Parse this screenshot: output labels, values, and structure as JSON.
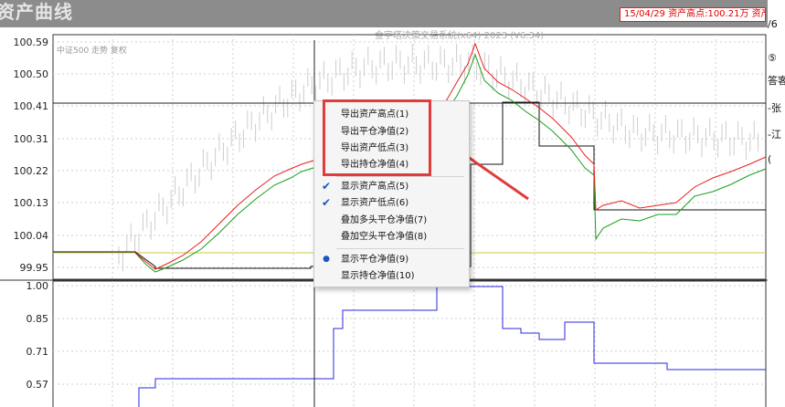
{
  "window": {
    "title": "资产曲线",
    "peak_info": "15/04/29 资产高点:100.21万  资产"
  },
  "chart": {
    "watermark": "金字塔决策交易系统(x64) 2023 (V6.34)",
    "symbol_label": "中证500 走势 复权",
    "upper_y_ticks": [
      "100.59",
      "100.50",
      "100.41",
      "100.31",
      "100.22",
      "100.13",
      "100.04",
      "99.95"
    ],
    "lower_y_ticks": [
      "1.00",
      "0.85",
      "0.71",
      "0.57"
    ],
    "colors": {
      "equity_high": "#e82020",
      "equity_low": "#1a9e1a",
      "close_equity": "#111111",
      "position": "#2a2ae0",
      "baseline": "#c8c83c",
      "price_bars": "#c8c8c8",
      "annotation": "#e03c3c"
    }
  },
  "context_menu": {
    "items": [
      {
        "label": "导出资产高点(1)",
        "checked": false,
        "bullet": false
      },
      {
        "label": "导出平仓净值(2)",
        "checked": false,
        "bullet": false
      },
      {
        "label": "导出资产低点(3)",
        "checked": false,
        "bullet": false
      },
      {
        "label": "导出持仓净值(4)",
        "checked": false,
        "bullet": false
      },
      {
        "label": "显示资产高点(5)",
        "checked": true,
        "bullet": false
      },
      {
        "label": "显示资产低点(6)",
        "checked": true,
        "bullet": false
      },
      {
        "label": "叠加多头平仓净值(7)",
        "checked": false,
        "bullet": false
      },
      {
        "label": "叠加空头平仓净值(8)",
        "checked": false,
        "bullet": false
      },
      {
        "label": "显示平仓净值(9)",
        "checked": false,
        "bullet": true
      },
      {
        "label": "显示持仓净值(10)",
        "checked": false,
        "bullet": false
      }
    ],
    "check_mark": "✔",
    "bullet_mark": "●"
  },
  "right_fragments": [
    "/6",
    "⑤",
    "答客",
    "-张",
    "-江",
    "("
  ]
}
